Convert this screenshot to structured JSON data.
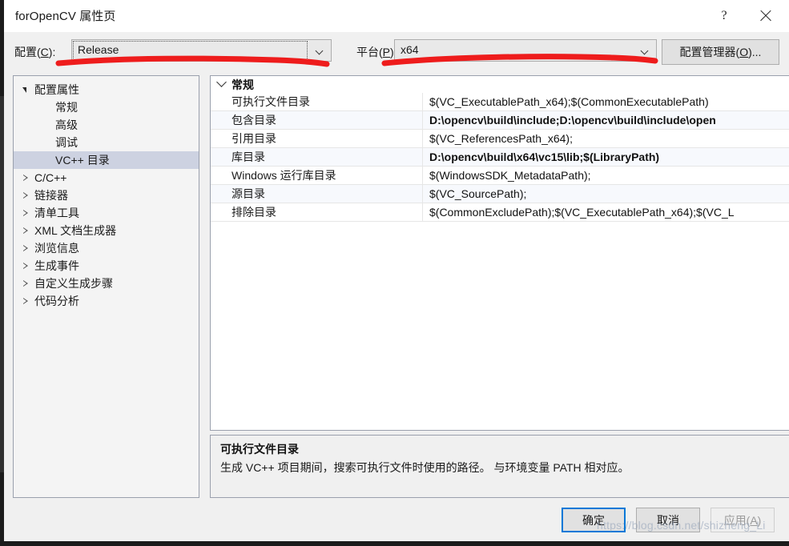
{
  "window": {
    "title": "forOpenCV 属性页",
    "help_glyph": "?",
    "close_glyph": "✕"
  },
  "config_bar": {
    "config_label": "配置(C):",
    "config_label_plain": "配置",
    "config_value": "Release",
    "platform_label": "平台(P):",
    "platform_value": "x64",
    "config_manager_button": "配置管理器(O)...",
    "annotation_color": "#ee1c1c"
  },
  "tree": {
    "items": [
      {
        "label": "配置属性",
        "indent": 0,
        "expander": "down",
        "selected": false
      },
      {
        "label": "常规",
        "indent": 1,
        "expander": "none",
        "selected": false
      },
      {
        "label": "高级",
        "indent": 1,
        "expander": "none",
        "selected": false
      },
      {
        "label": "调试",
        "indent": 1,
        "expander": "none",
        "selected": false
      },
      {
        "label": "VC++ 目录",
        "indent": 1,
        "expander": "none",
        "selected": true
      },
      {
        "label": "C/C++",
        "indent": 0,
        "expander": "right",
        "selected": false
      },
      {
        "label": "链接器",
        "indent": 0,
        "expander": "right",
        "selected": false
      },
      {
        "label": "清单工具",
        "indent": 0,
        "expander": "right",
        "selected": false
      },
      {
        "label": "XML 文档生成器",
        "indent": 0,
        "expander": "right",
        "selected": false
      },
      {
        "label": "浏览信息",
        "indent": 0,
        "expander": "right",
        "selected": false
      },
      {
        "label": "生成事件",
        "indent": 0,
        "expander": "right",
        "selected": false
      },
      {
        "label": "自定义生成步骤",
        "indent": 0,
        "expander": "right",
        "selected": false
      },
      {
        "label": "代码分析",
        "indent": 0,
        "expander": "right",
        "selected": false
      }
    ],
    "selection_color": "#cdd2e1"
  },
  "grid": {
    "category": "常规",
    "rows": [
      {
        "name": "可执行文件目录",
        "value": "$(VC_ExecutablePath_x64);$(CommonExecutablePath)",
        "modified": false
      },
      {
        "name": "包含目录",
        "value": "D:\\opencv\\build\\include;D:\\opencv\\build\\include\\open",
        "modified": true
      },
      {
        "name": "引用目录",
        "value": "$(VC_ReferencesPath_x64);",
        "modified": false
      },
      {
        "name": "库目录",
        "value": "D:\\opencv\\build\\x64\\vc15\\lib;$(LibraryPath)",
        "modified": true
      },
      {
        "name": "Windows 运行库目录",
        "value": "$(WindowsSDK_MetadataPath);",
        "modified": false
      },
      {
        "name": "源目录",
        "value": "$(VC_SourcePath);",
        "modified": false
      },
      {
        "name": "排除目录",
        "value": "$(CommonExcludePath);$(VC_ExecutablePath_x64);$(VC_L",
        "modified": false
      }
    ]
  },
  "description": {
    "title": "可执行文件目录",
    "body": "生成 VC++ 项目期间，搜索可执行文件时使用的路径。  与环境变量 PATH 相对应。"
  },
  "footer": {
    "ok": "确定",
    "cancel": "取消",
    "apply": "应用(A)"
  },
  "watermark": "https://blog.csdn.net/shizheng_Li"
}
